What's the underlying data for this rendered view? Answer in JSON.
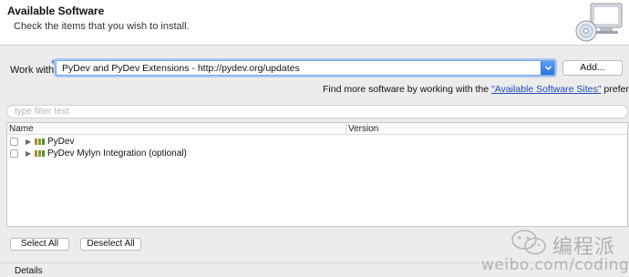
{
  "header": {
    "title": "Available Software",
    "subtitle": "Check the items that you wish to install.",
    "icon": "install-cd-computer-icon"
  },
  "work_with": {
    "label": "Work with:",
    "value": "PyDev and PyDev Extensions - http://pydev.org/updates",
    "add_button": "Add..."
  },
  "find_more": {
    "prefix": "Find more software by working with the ",
    "link": "\"Available Software Sites\"",
    "suffix": " preferences."
  },
  "filter": {
    "placeholder": "type filter text"
  },
  "table": {
    "columns": [
      "Name",
      "Version"
    ],
    "rows": [
      {
        "label": "PyDev",
        "checked": false
      },
      {
        "label": "PyDev Mylyn Integration (optional)",
        "checked": false
      }
    ]
  },
  "buttons": {
    "select_all": "Select All",
    "deselect_all": "Deselect All"
  },
  "details": {
    "label": "Details"
  },
  "watermark": {
    "text": "编程派",
    "sub": "weibo.com/codingpy"
  },
  "colors": {
    "accent": "#2b73e0",
    "link": "#1f47b8",
    "background": "#ececec"
  }
}
